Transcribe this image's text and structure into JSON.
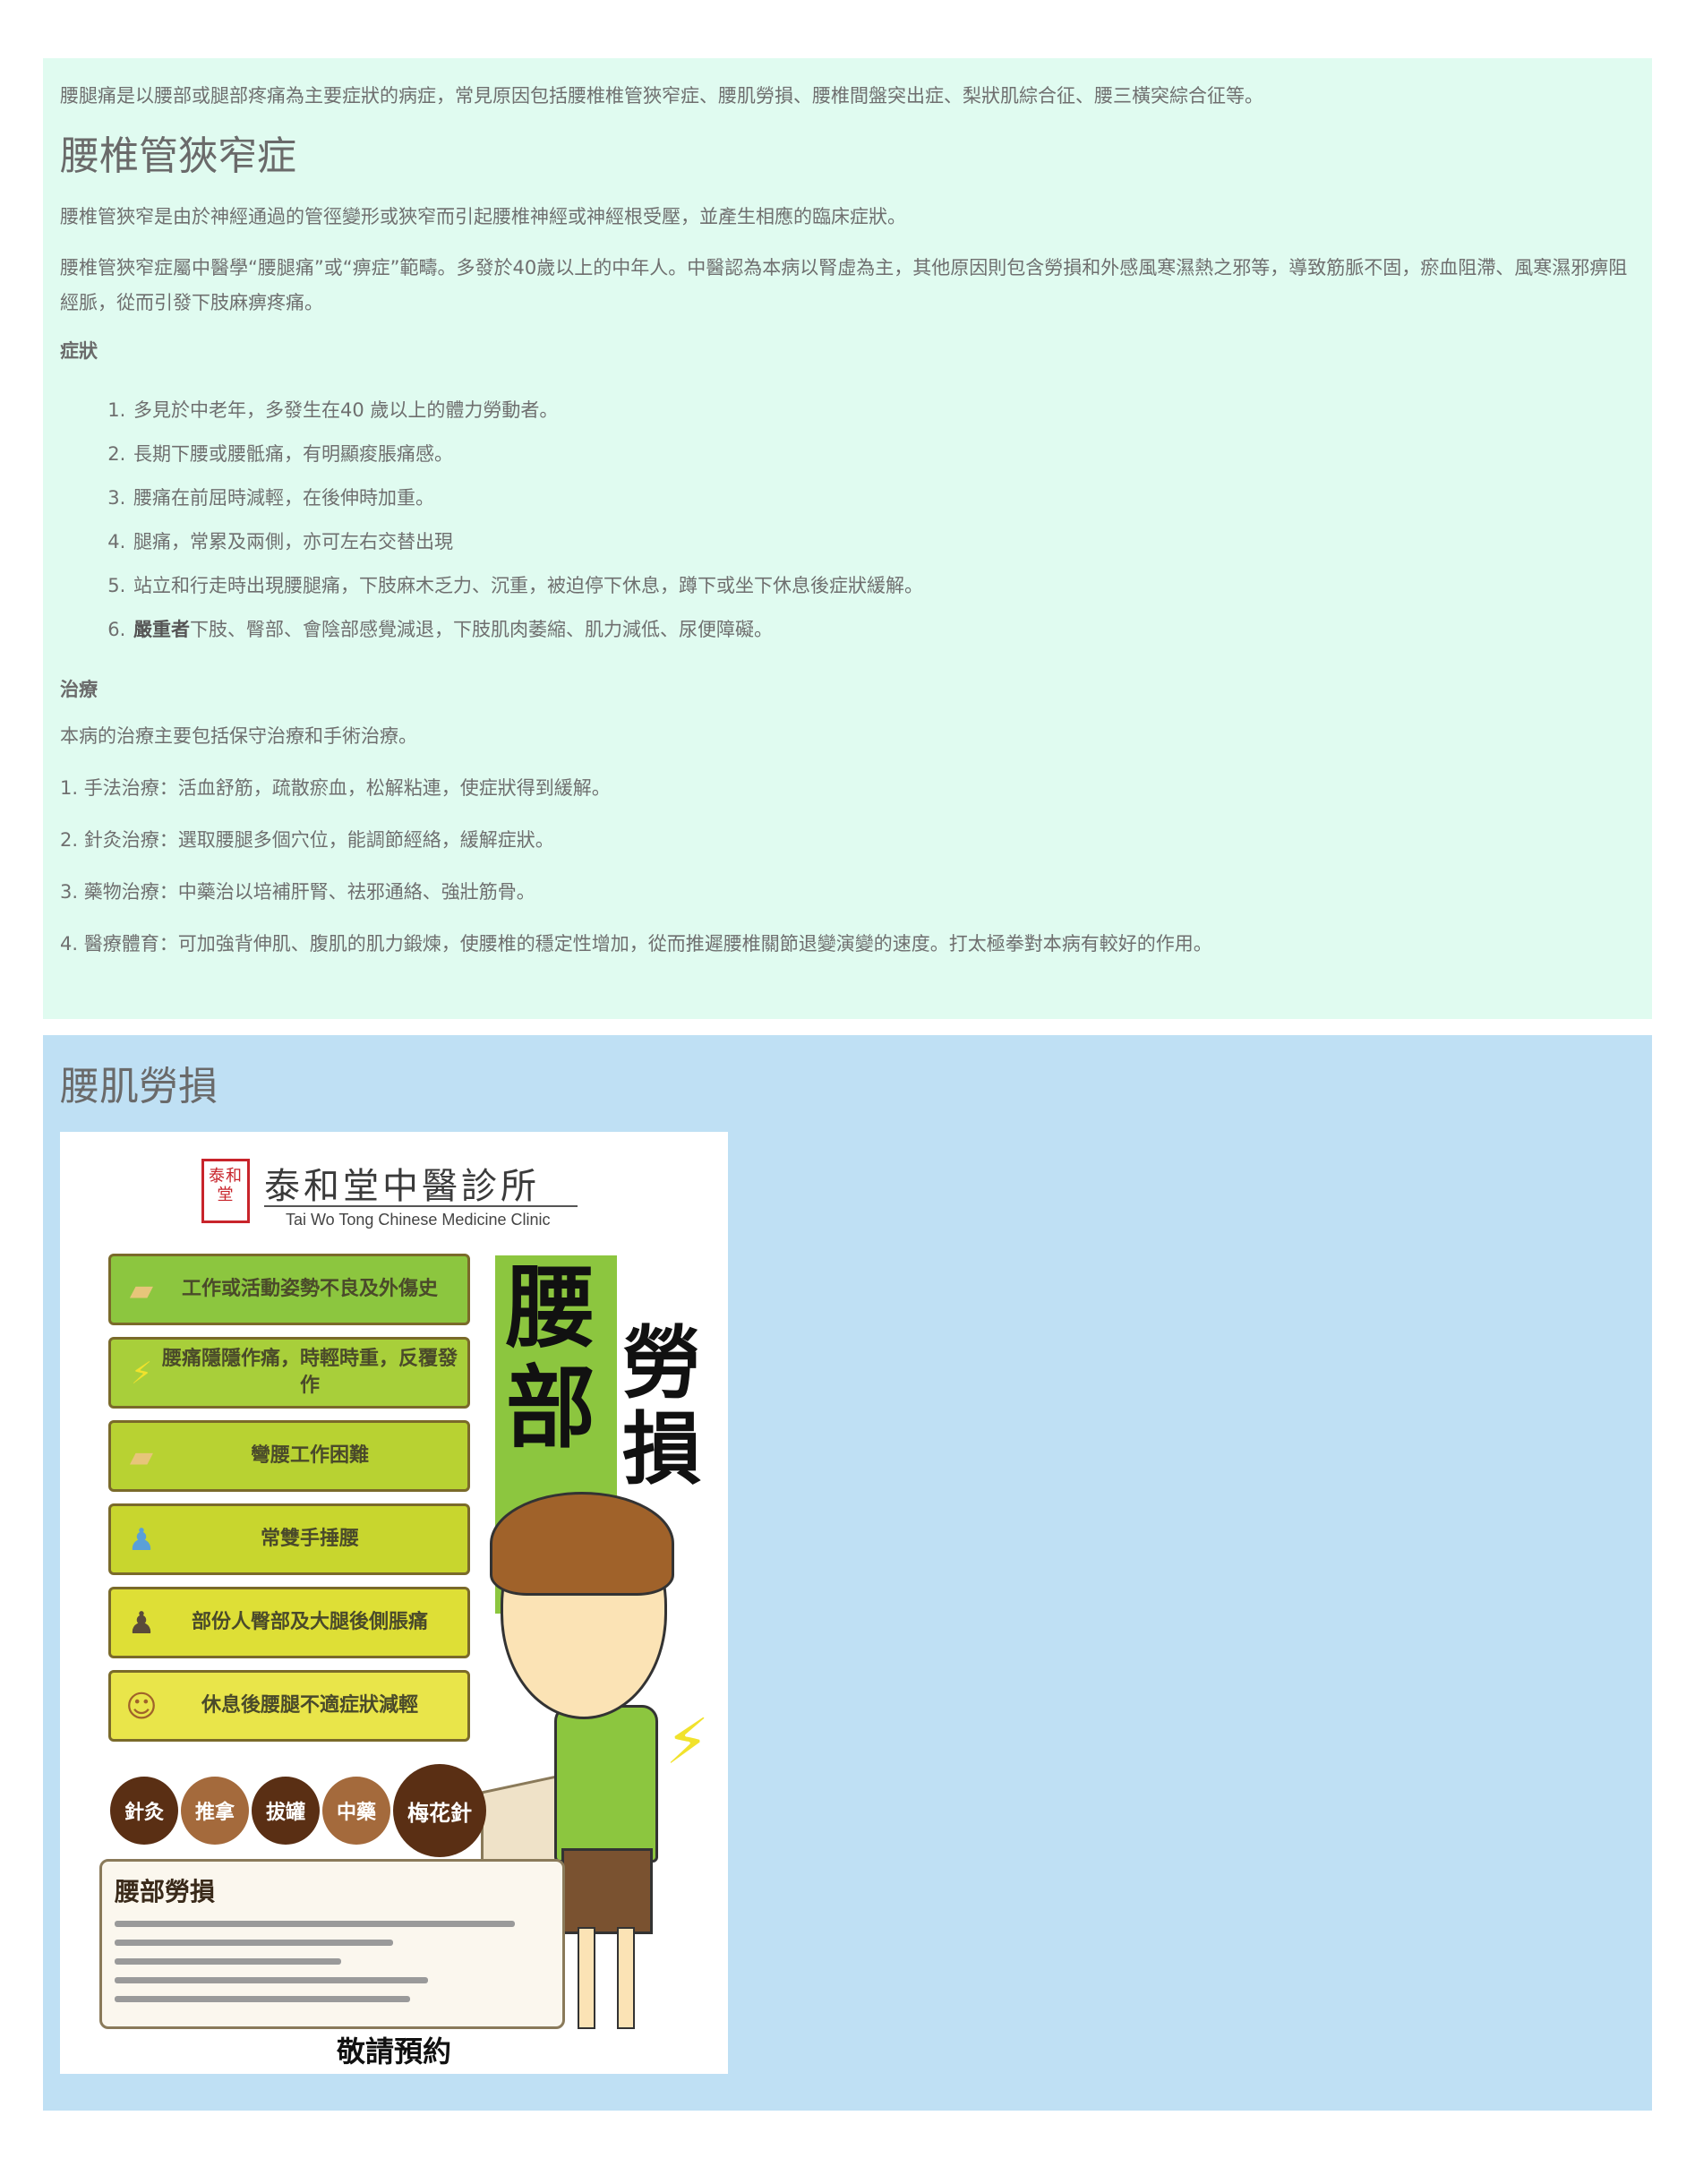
{
  "section1": {
    "intro": "腰腿痛是以腰部或腿部疼痛為主要症狀的病症，常見原因包括腰椎椎管狹窄症、腰肌勞損、腰椎間盤突出症、梨狀肌綜合征、腰三橫突綜合征等。",
    "title": "腰椎管狹窄症",
    "definition": "腰椎管狹窄是由於神經通過的管徑變形或狹窄而引起腰椎神經或神經根受壓，並產生相應的臨床症狀。",
    "tcm_view": "腰椎管狹窄症屬中醫學“腰腿痛”或“痹症”範疇。多發於40歲以上的中年人。中醫認為本病以腎虛為主，其他原因則包含勞損和外感風寒濕熱之邪等，導致筋脈不固，瘀血阻滯、風寒濕邪痹阻經脈，從而引發下肢麻痹疼痛。",
    "symptoms_heading": "症狀",
    "symptoms": [
      "多見於中老年，多發生在40 歲以上的體力勞動者。",
      "長期下腰或腰骶痛，有明顯痠脹痛感。",
      "腰痛在前屈時減輕，在後伸時加重。",
      "腿痛，常累及兩側，亦可左右交替出現",
      "站立和行走時出現腰腿痛，下肢麻木乏力、沉重，被迫停下休息，蹲下或坐下休息後症狀緩解。"
    ],
    "symptom6_bold": "嚴重者",
    "symptom6_rest": "下肢、臀部、會陰部感覺減退，下肢肌肉萎縮、肌力減低、尿便障礙。",
    "treatment_heading": "治療",
    "treatment_intro": "本病的治療主要包括保守治療和手術治療。",
    "treatments": [
      "1. 手法治療：活血舒筋，疏散瘀血，松解粘連，使症狀得到緩解。",
      "2. 針灸治療：選取腰腿多個穴位，能調節經絡，緩解症狀。",
      "3. 藥物治療：中藥治以培補肝腎、祛邪通絡、強壯筋骨。",
      "4. 醫療體育：可加強背伸肌、腹肌的肌力鍛煉，使腰椎的穩定性增加，從而推遲腰椎關節退變演變的速度。打太極拳對本病有較好的作用。"
    ]
  },
  "section2": {
    "title": "腰肌勞損",
    "poster": {
      "seal_text": "泰和堂",
      "clinic_name_cn": "泰和堂中醫診所",
      "clinic_name_en": "Tai Wo Tong Chinese Medicine Clinic",
      "symptom_boxes": [
        {
          "text": "工作或活動姿勢不良及外傷史",
          "icon": "box-icon"
        },
        {
          "text": "腰痛隱隱作痛，時輕時重，反覆發作",
          "icon": "lightning-icon"
        },
        {
          "text": "彎腰工作困難",
          "icon": "box-icon"
        },
        {
          "text": "常雙手捶腰",
          "icon": "person-icon"
        },
        {
          "text": "部份人臀部及大腿後側脹痛",
          "icon": "person-icon"
        },
        {
          "text": "休息後腰腿不適症狀減輕",
          "icon": "face-icon"
        }
      ],
      "big_text_1": "腰部",
      "big_text_2": "勞損",
      "treatments": [
        "針灸",
        "推拿",
        "拔罐",
        "中藥",
        "梅花針"
      ],
      "desc_title": "腰部勞損",
      "reserve": "敬請預約"
    }
  },
  "colors": {
    "section1_bg": "#e0fbf0",
    "section2_bg": "#bfe0f4",
    "text": "#6f6f6f"
  }
}
